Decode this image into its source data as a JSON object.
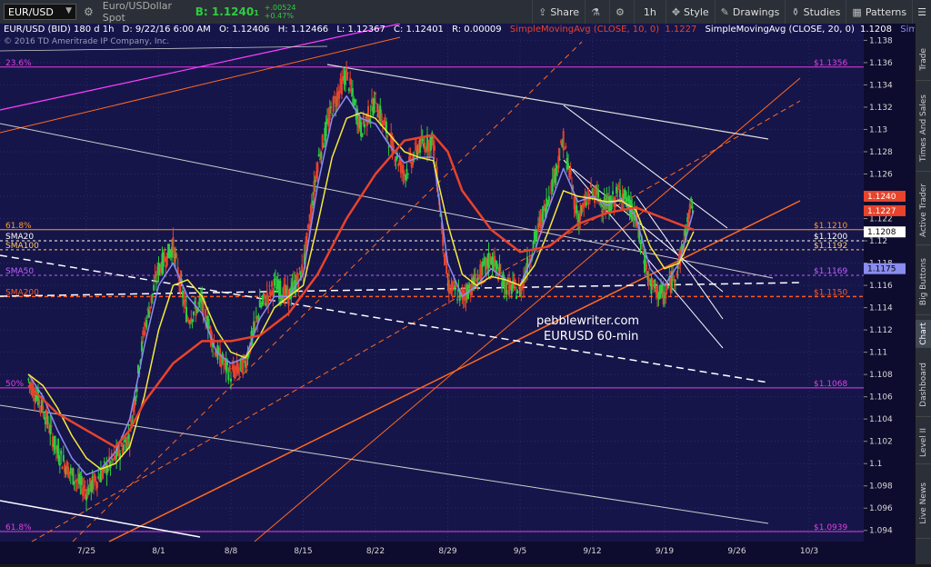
{
  "toolbar": {
    "symbol": "EUR/USD",
    "description": "Euro/USDollar Spot",
    "bid_label": "B:",
    "bid": "1.1240",
    "bid_frac": "1",
    "change": "+.00524",
    "change_pct": "+0.47%",
    "share": "Share",
    "timeframe": "1h",
    "style": "Style",
    "drawings": "Drawings",
    "studies": "Studies",
    "patterns": "Patterns"
  },
  "header": {
    "title": "EUR/USD (BID) 180 d 1h",
    "date": "D: 9/22/16 6:00 AM",
    "open": "O: 1.12406",
    "high": "H: 1.12466",
    "low": "L: 1.12367",
    "close": "C: 1.12401",
    "range": "R: 0.00009",
    "sma10": "SimpleMovingAvg (CLOSE, 10, 0)",
    "sma10_val": "1.1227",
    "sma20": "SimpleMovingAvg (CLOSE, 20, 0)",
    "sma20_val": "1.1208",
    "more": "Simp...",
    "copyright": "© 2016 TD Ameritrade IP Company, Inc."
  },
  "side_tabs": [
    "Trade",
    "Times And Sales",
    "Active Trader",
    "Big Buttons",
    "Chart",
    "Dashboard",
    "Level II",
    "Live News"
  ],
  "watermark": [
    "pebblewriter.com",
    "EURUSD 60-min"
  ],
  "colors": {
    "background": "#16154a",
    "candle_up": "#2ecc40",
    "candle_down": "#e8432b",
    "sma10": "#8a8cf0",
    "sma20": "#f5ea3a",
    "sma50": "#e8432b",
    "fib": "#e040e0",
    "channel": "#ff5a1e"
  },
  "chart_data": {
    "type": "line",
    "y_range": [
      1.093,
      1.1395
    ],
    "y_ticks": [
      "1.138",
      "1.136",
      "1.134",
      "1.132",
      "1.13",
      "1.128",
      "1.126",
      "1.124",
      "1.122",
      "1.12",
      "1.118",
      "1.116",
      "1.114",
      "1.112",
      "1.11",
      "1.108",
      "1.106",
      "1.104",
      "1.102",
      "1.1",
      "1.098",
      "1.096",
      "1.094"
    ],
    "x_ticks": [
      {
        "label": "7/25",
        "x": 4
      },
      {
        "label": "8/1",
        "x": 9
      },
      {
        "label": "8/8",
        "x": 14
      },
      {
        "label": "8/15",
        "x": 19
      },
      {
        "label": "8/22",
        "x": 24
      },
      {
        "label": "8/29",
        "x": 29
      },
      {
        "label": "9/5",
        "x": 34
      },
      {
        "label": "9/12",
        "x": 39
      },
      {
        "label": "9/19",
        "x": 44
      },
      {
        "label": "9/26",
        "x": 49
      },
      {
        "label": "10/3",
        "x": 54
      }
    ],
    "x_range": [
      0,
      61
    ],
    "series": [
      {
        "name": "Close",
        "values": [
          [
            0,
            1.1075
          ],
          [
            1,
            1.105
          ],
          [
            2,
            1.101
          ],
          [
            3,
            1.099
          ],
          [
            4,
            1.0975
          ],
          [
            5,
            1.099
          ],
          [
            6,
            1.1005
          ],
          [
            7,
            1.1025
          ],
          [
            8,
            1.112
          ],
          [
            9,
            1.1175
          ],
          [
            10,
            1.1195
          ],
          [
            11,
            1.113
          ],
          [
            12,
            1.1145
          ],
          [
            13,
            1.11
          ],
          [
            14,
            1.108
          ],
          [
            15,
            1.109
          ],
          [
            16,
            1.114
          ],
          [
            17,
            1.116
          ],
          [
            18,
            1.115
          ],
          [
            19,
            1.1175
          ],
          [
            20,
            1.127
          ],
          [
            21,
            1.132
          ],
          [
            22,
            1.135
          ],
          [
            23,
            1.13
          ],
          [
            24,
            1.1325
          ],
          [
            25,
            1.129
          ],
          [
            26,
            1.126
          ],
          [
            27,
            1.1285
          ],
          [
            28,
            1.129
          ],
          [
            29,
            1.116
          ],
          [
            30,
            1.115
          ],
          [
            31,
            1.1165
          ],
          [
            32,
            1.1185
          ],
          [
            33,
            1.116
          ],
          [
            34,
            1.1155
          ],
          [
            35,
            1.12
          ],
          [
            36,
            1.124
          ],
          [
            37,
            1.129
          ],
          [
            38,
            1.122
          ],
          [
            39,
            1.1245
          ],
          [
            40,
            1.123
          ],
          [
            41,
            1.1245
          ],
          [
            42,
            1.122
          ],
          [
            43,
            1.116
          ],
          [
            44,
            1.115
          ],
          [
            45,
            1.118
          ],
          [
            46,
            1.124
          ]
        ]
      },
      {
        "name": "SimpleMovingAvg (CLOSE, 10, 0)",
        "values": [
          [
            0,
            1.108
          ],
          [
            1,
            1.106
          ],
          [
            2,
            1.103
          ],
          [
            3,
            1.1005
          ],
          [
            4,
            1.099
          ],
          [
            5,
            1.0995
          ],
          [
            6,
            1.101
          ],
          [
            7,
            1.104
          ],
          [
            8,
            1.1105
          ],
          [
            9,
            1.116
          ],
          [
            10,
            1.118
          ],
          [
            11,
            1.115
          ],
          [
            12,
            1.1135
          ],
          [
            13,
            1.11
          ],
          [
            14,
            1.109
          ],
          [
            15,
            1.1095
          ],
          [
            16,
            1.113
          ],
          [
            17,
            1.115
          ],
          [
            18,
            1.115
          ],
          [
            19,
            1.117
          ],
          [
            20,
            1.125
          ],
          [
            21,
            1.131
          ],
          [
            22,
            1.133
          ],
          [
            23,
            1.131
          ],
          [
            24,
            1.1305
          ],
          [
            25,
            1.1285
          ],
          [
            26,
            1.127
          ],
          [
            27,
            1.1275
          ],
          [
            28,
            1.1275
          ],
          [
            29,
            1.118
          ],
          [
            30,
            1.115
          ],
          [
            31,
            1.116
          ],
          [
            32,
            1.1175
          ],
          [
            33,
            1.1165
          ],
          [
            34,
            1.116
          ],
          [
            35,
            1.119
          ],
          [
            36,
            1.123
          ],
          [
            37,
            1.1265
          ],
          [
            38,
            1.1235
          ],
          [
            39,
            1.124
          ],
          [
            40,
            1.1232
          ],
          [
            41,
            1.1238
          ],
          [
            42,
            1.1222
          ],
          [
            43,
            1.1175
          ],
          [
            44,
            1.116
          ],
          [
            45,
            1.118
          ],
          [
            46,
            1.1227
          ]
        ]
      },
      {
        "name": "SimpleMovingAvg (CLOSE, 20, 0)",
        "values": [
          [
            0,
            1.108
          ],
          [
            1,
            1.107
          ],
          [
            2,
            1.105
          ],
          [
            3,
            1.1025
          ],
          [
            4,
            1.1005
          ],
          [
            5,
            1.0995
          ],
          [
            6,
            1.1
          ],
          [
            7,
            1.1015
          ],
          [
            8,
            1.106
          ],
          [
            9,
            1.112
          ],
          [
            10,
            1.116
          ],
          [
            11,
            1.1165
          ],
          [
            12,
            1.115
          ],
          [
            13,
            1.112
          ],
          [
            14,
            1.11
          ],
          [
            15,
            1.1095
          ],
          [
            16,
            1.1115
          ],
          [
            17,
            1.114
          ],
          [
            18,
            1.115
          ],
          [
            19,
            1.116
          ],
          [
            20,
            1.1215
          ],
          [
            21,
            1.1275
          ],
          [
            22,
            1.131
          ],
          [
            23,
            1.1315
          ],
          [
            24,
            1.131
          ],
          [
            25,
            1.1295
          ],
          [
            26,
            1.128
          ],
          [
            27,
            1.1275
          ],
          [
            28,
            1.1272
          ],
          [
            29,
            1.1215
          ],
          [
            30,
            1.117
          ],
          [
            31,
            1.116
          ],
          [
            32,
            1.1168
          ],
          [
            33,
            1.1165
          ],
          [
            34,
            1.116
          ],
          [
            35,
            1.1178
          ],
          [
            36,
            1.121
          ],
          [
            37,
            1.1245
          ],
          [
            38,
            1.124
          ],
          [
            39,
            1.1238
          ],
          [
            40,
            1.1235
          ],
          [
            41,
            1.1236
          ],
          [
            42,
            1.1228
          ],
          [
            43,
            1.1195
          ],
          [
            44,
            1.1175
          ],
          [
            45,
            1.118
          ],
          [
            46,
            1.1208
          ]
        ]
      },
      {
        "name": "SMA50",
        "values": [
          [
            0,
            1.107
          ],
          [
            2,
            1.1045
          ],
          [
            4,
            1.103
          ],
          [
            6,
            1.1015
          ],
          [
            7,
            1.103
          ],
          [
            8,
            1.1055
          ],
          [
            10,
            1.109
          ],
          [
            12,
            1.111
          ],
          [
            14,
            1.111
          ],
          [
            16,
            1.1115
          ],
          [
            18,
            1.1135
          ],
          [
            20,
            1.117
          ],
          [
            22,
            1.122
          ],
          [
            24,
            1.126
          ],
          [
            26,
            1.129
          ],
          [
            28,
            1.1295
          ],
          [
            29,
            1.128
          ],
          [
            30,
            1.1245
          ],
          [
            32,
            1.121
          ],
          [
            34,
            1.119
          ],
          [
            36,
            1.1195
          ],
          [
            38,
            1.1215
          ],
          [
            40,
            1.1225
          ],
          [
            42,
            1.123
          ],
          [
            44,
            1.122
          ],
          [
            46,
            1.121
          ]
        ]
      }
    ],
    "levels": [
      {
        "label": "23.6%",
        "price": "1.1356",
        "value": 1.1356,
        "color": "#e040e0"
      },
      {
        "label": "61.8%",
        "price": "1.1210",
        "value": 1.121,
        "color": "#ff9a2a"
      },
      {
        "label": "SMA20",
        "price": "1.1200",
        "value": 1.12,
        "color": "#ffffff"
      },
      {
        "label": "SMA100",
        "price": "1.1192",
        "value": 1.1192,
        "color": "#ffcc66"
      },
      {
        "label": "SMA50",
        "price": "1.1169",
        "value": 1.1169,
        "color": "#c060ff"
      },
      {
        "label": "SMA200",
        "price": "1.1150",
        "value": 1.115,
        "color": "#ff5a1e"
      },
      {
        "label": "50%",
        "price": "1.1068",
        "value": 1.1068,
        "color": "#e040e0"
      },
      {
        "label": "61.8%",
        "price": "1.0939",
        "value": 1.0939,
        "color": "#e040e0"
      }
    ],
    "price_flags": [
      {
        "price": "1.1240",
        "value": 1.124,
        "bg": "#e8432b",
        "fg": "#ffffff"
      },
      {
        "price": "1.1227",
        "value": 1.1227,
        "bg": "#e8432b",
        "fg": "#ffffff"
      },
      {
        "price": "1.1208",
        "value": 1.1208,
        "bg": "#ffffff",
        "fg": "#000000"
      },
      {
        "price": "1.1175",
        "value": 1.1175,
        "bg": "#8a8cf0",
        "fg": "#000000"
      }
    ],
    "grid": true
  }
}
